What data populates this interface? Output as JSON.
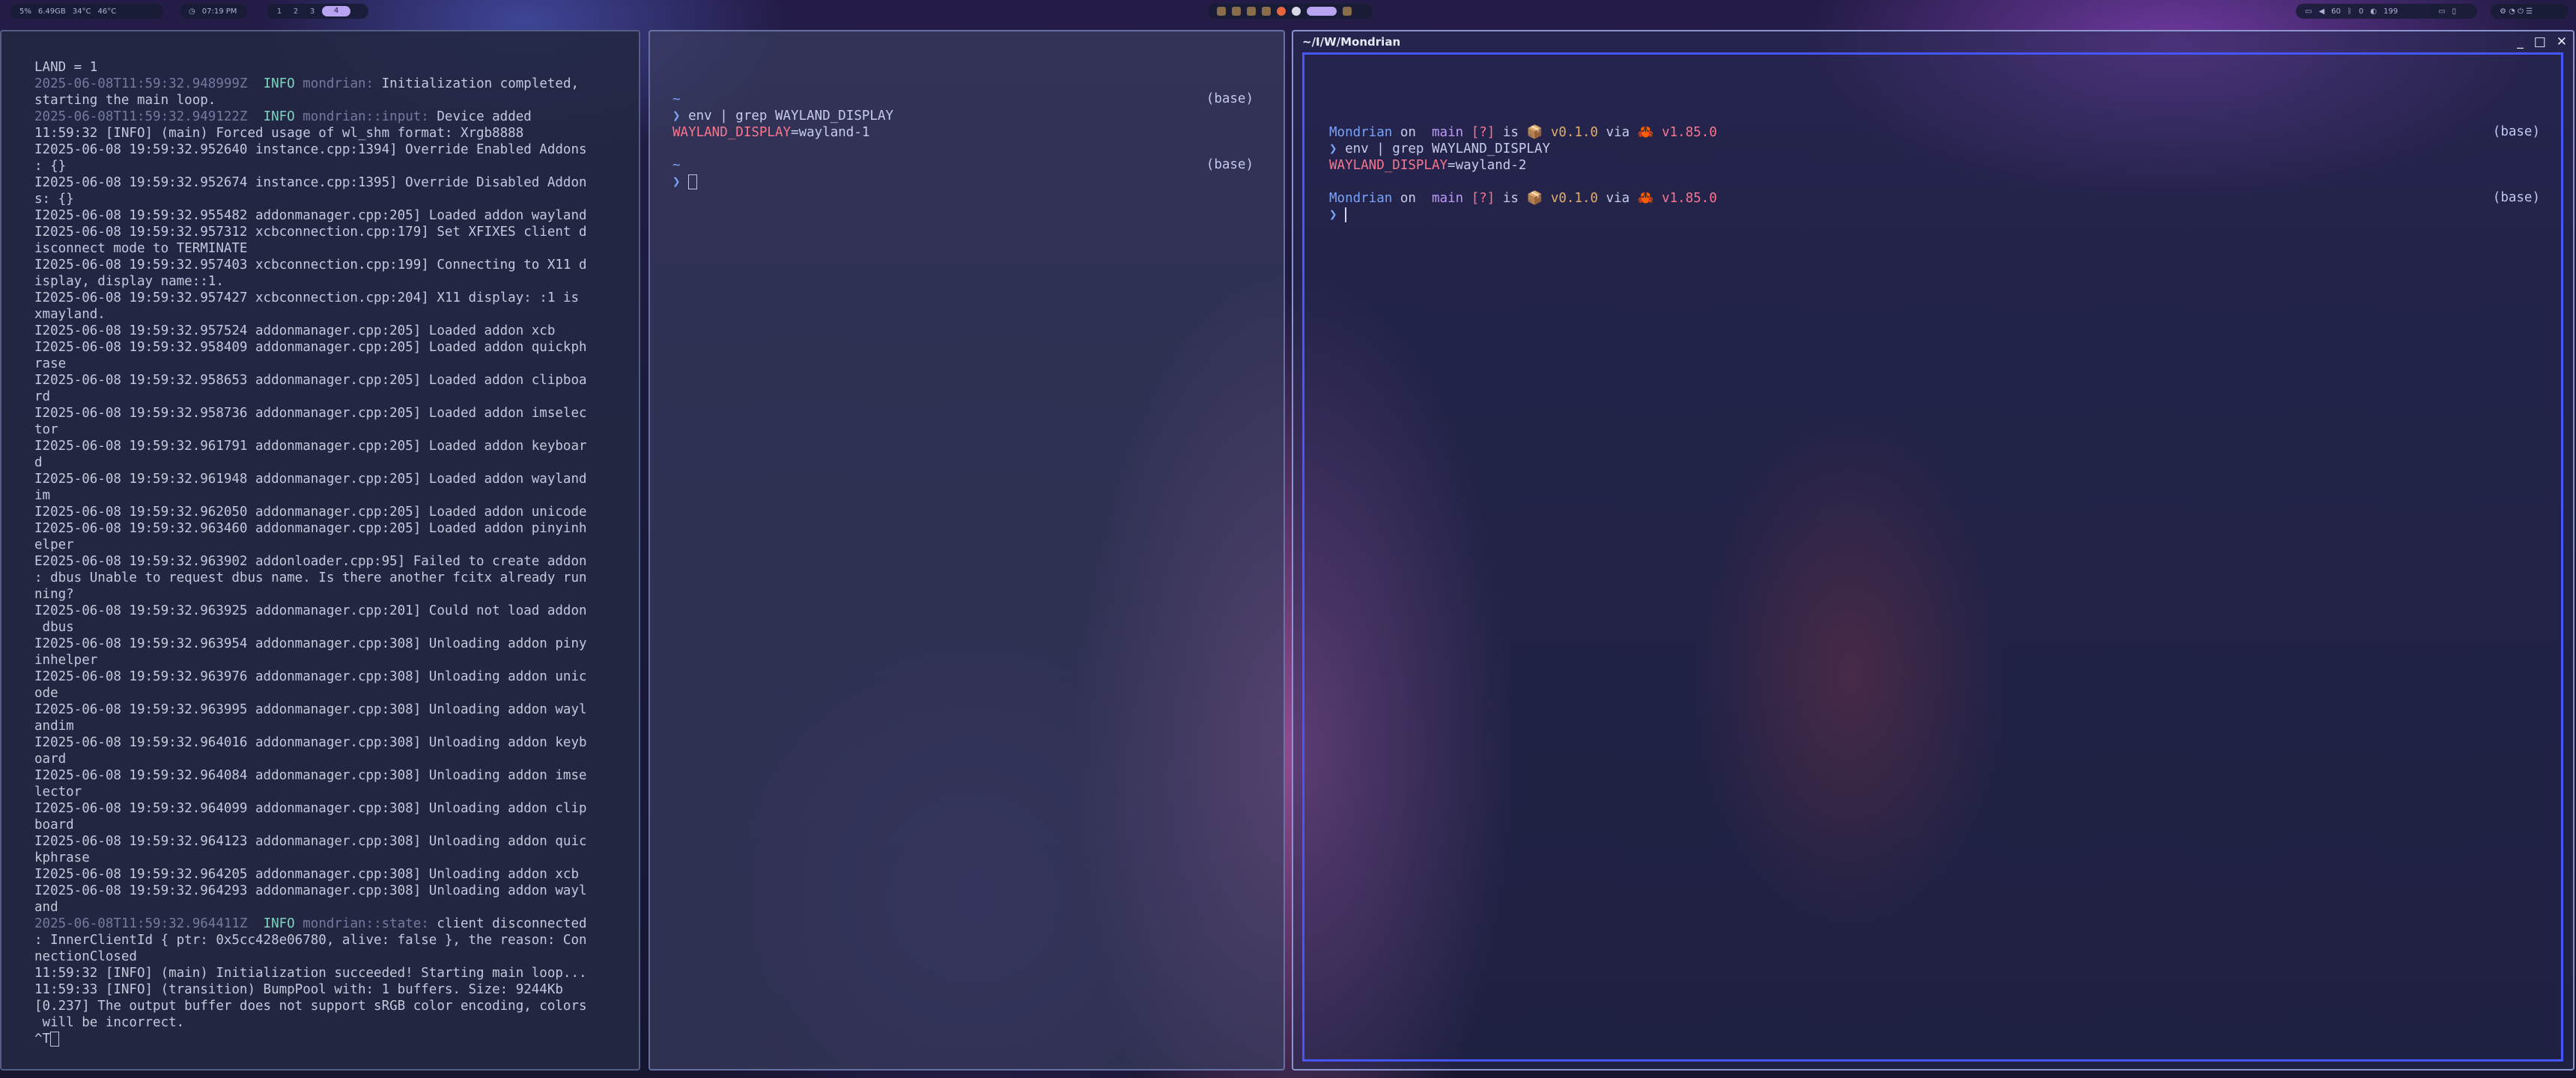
{
  "topbar": {
    "status_left": [
      "5%",
      "6.49GB",
      "34°C",
      "46°C"
    ],
    "clock": "07:19 PM",
    "workspaces": [
      "1",
      "2",
      "3",
      "4"
    ],
    "active_workspace": "4",
    "tray_icons": [
      "archive-icon",
      "archive-icon",
      "archive-icon",
      "archive-icon",
      "firefox-icon",
      "chrome-icon",
      "app-icon",
      "app-icon"
    ],
    "status_right": [
      "60",
      "0",
      "199"
    ],
    "colors": {
      "accent": "#b9a4f2",
      "bar_bg": "#181c34"
    }
  },
  "term_left": {
    "lines": [
      {
        "t": "LAND = 1"
      },
      {
        "ts": "2025-06-08T11:59:32.948999Z",
        "lvl": "INFO",
        "mod": "mondrian:",
        "msg": "Initialization completed,"
      },
      {
        "t": "starting the main loop."
      },
      {
        "ts": "2025-06-08T11:59:32.949122Z",
        "lvl": "INFO",
        "mod": "mondrian::input:",
        "msg": "Device added"
      },
      {
        "t": "11:59:32 [INFO] (main) Forced usage of wl_shm format: Xrgb8888"
      },
      {
        "t": "I2025-06-08 19:59:32.952640 instance.cpp:1394] Override Enabled Addons"
      },
      {
        "t": ": {}"
      },
      {
        "t": "I2025-06-08 19:59:32.952674 instance.cpp:1395] Override Disabled Addon"
      },
      {
        "t": "s: {}"
      },
      {
        "t": "I2025-06-08 19:59:32.955482 addonmanager.cpp:205] Loaded addon wayland"
      },
      {
        "t": "I2025-06-08 19:59:32.957312 xcbconnection.cpp:179] Set XFIXES client d"
      },
      {
        "t": "isconnect mode to TERMINATE"
      },
      {
        "t": "I2025-06-08 19:59:32.957403 xcbconnection.cpp:199] Connecting to X11 d"
      },
      {
        "t": "isplay, display name::1."
      },
      {
        "t": "I2025-06-08 19:59:32.957427 xcbconnection.cpp:204] X11 display: :1 is"
      },
      {
        "t": "xmayland."
      },
      {
        "t": "I2025-06-08 19:59:32.957524 addonmanager.cpp:205] Loaded addon xcb"
      },
      {
        "t": "I2025-06-08 19:59:32.958409 addonmanager.cpp:205] Loaded addon quickph"
      },
      {
        "t": "rase"
      },
      {
        "t": "I2025-06-08 19:59:32.958653 addonmanager.cpp:205] Loaded addon clipboa"
      },
      {
        "t": "rd"
      },
      {
        "t": "I2025-06-08 19:59:32.958736 addonmanager.cpp:205] Loaded addon imselec"
      },
      {
        "t": "tor"
      },
      {
        "t": "I2025-06-08 19:59:32.961791 addonmanager.cpp:205] Loaded addon keyboar"
      },
      {
        "t": "d"
      },
      {
        "t": "I2025-06-08 19:59:32.961948 addonmanager.cpp:205] Loaded addon wayland"
      },
      {
        "t": "im"
      },
      {
        "t": "I2025-06-08 19:59:32.962050 addonmanager.cpp:205] Loaded addon unicode"
      },
      {
        "t": "I2025-06-08 19:59:32.963460 addonmanager.cpp:205] Loaded addon pinyinh"
      },
      {
        "t": "elper"
      },
      {
        "t": "E2025-06-08 19:59:32.963902 addonloader.cpp:95] Failed to create addon"
      },
      {
        "t": ": dbus Unable to request dbus name. Is there another fcitx already run"
      },
      {
        "t": "ning?"
      },
      {
        "t": "I2025-06-08 19:59:32.963925 addonmanager.cpp:201] Could not load addon"
      },
      {
        "t": " dbus"
      },
      {
        "t": "I2025-06-08 19:59:32.963954 addonmanager.cpp:308] Unloading addon piny"
      },
      {
        "t": "inhelper"
      },
      {
        "t": "I2025-06-08 19:59:32.963976 addonmanager.cpp:308] Unloading addon unic"
      },
      {
        "t": "ode"
      },
      {
        "t": "I2025-06-08 19:59:32.963995 addonmanager.cpp:308] Unloading addon wayl"
      },
      {
        "t": "andim"
      },
      {
        "t": "I2025-06-08 19:59:32.964016 addonmanager.cpp:308] Unloading addon keyb"
      },
      {
        "t": "oard"
      },
      {
        "t": "I2025-06-08 19:59:32.964084 addonmanager.cpp:308] Unloading addon imse"
      },
      {
        "t": "lector"
      },
      {
        "t": "I2025-06-08 19:59:32.964099 addonmanager.cpp:308] Unloading addon clip"
      },
      {
        "t": "board"
      },
      {
        "t": "I2025-06-08 19:59:32.964123 addonmanager.cpp:308] Unloading addon quic"
      },
      {
        "t": "kphrase"
      },
      {
        "t": "I2025-06-08 19:59:32.964205 addonmanager.cpp:308] Unloading addon xcb"
      },
      {
        "t": "I2025-06-08 19:59:32.964293 addonmanager.cpp:308] Unloading addon wayl"
      },
      {
        "t": "and"
      },
      {
        "ts": "2025-06-08T11:59:32.964411Z",
        "lvl": "INFO",
        "mod": "mondrian::state:",
        "msg": "client disconnected"
      },
      {
        "t": ": InnerClientId { ptr: 0x5cc428e06780, alive: false }, the reason: Con"
      },
      {
        "t": "nectionClosed"
      },
      {
        "t": "11:59:32 [INFO] (main) Initialization succeeded! Starting main loop..."
      },
      {
        "t": "11:59:33 [INFO] (transition) BumpPool with: 1 buffers. Size: 9244Kb"
      },
      {
        "t": "[0.237] The output buffer does not support sRGB color encoding, colors"
      },
      {
        "t": " will be incorrect."
      },
      {
        "t": "^T",
        "cursor": true
      }
    ]
  },
  "term_mid": {
    "dir": "~",
    "prompt": "❯",
    "command": "env | grep WAYLAND_DISPLAY",
    "env_key": "WAYLAND_DISPLAY",
    "env_val": "=wayland-1",
    "env_tag": "(base)"
  },
  "term_right": {
    "title": "~/I/W/Mondrian",
    "controls": [
      "_",
      "□",
      "✕"
    ],
    "repo": "Mondrian",
    "on": "on",
    "branch_icon": "",
    "branch": "main",
    "status": "[?]",
    "is": "is",
    "pkg_icon": "📦",
    "version": "v0.1.0",
    "via": "via",
    "rust_icon": "🦀",
    "rust_version": "v1.85.0",
    "prompt": "❯",
    "command": "env | grep WAYLAND_DISPLAY",
    "env_key": "WAYLAND_DISPLAY",
    "env_val": "=wayland-2",
    "env_tag": "(base)"
  }
}
